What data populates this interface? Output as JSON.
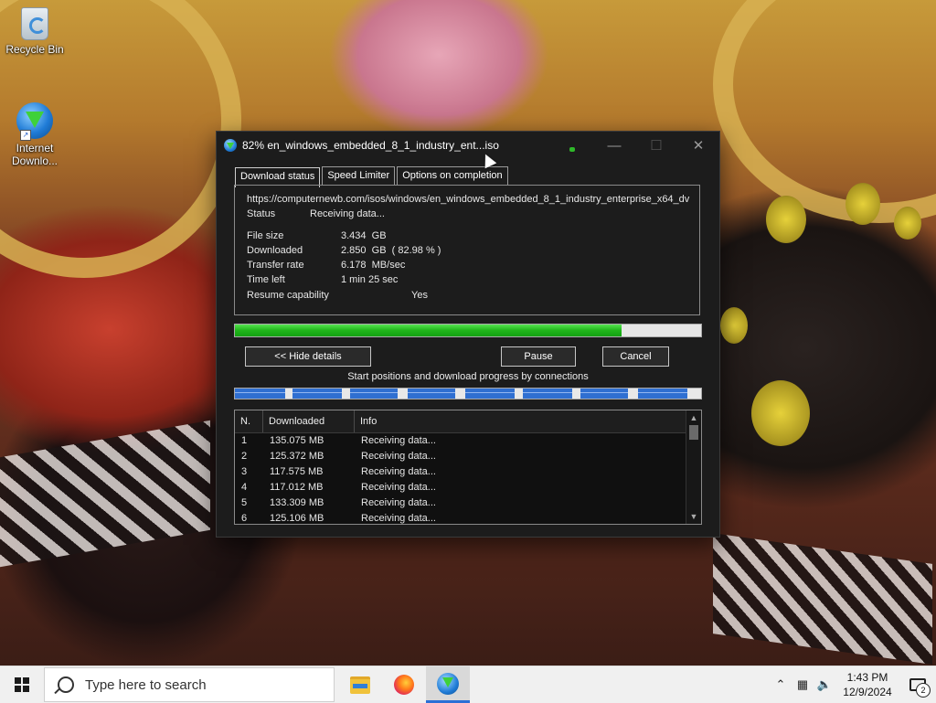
{
  "desktop": {
    "icons": [
      {
        "label": "Recycle Bin",
        "icon": "recycle-bin-icon"
      },
      {
        "label": "Internet\nDownlo...",
        "icon": "idm-icon"
      }
    ]
  },
  "dialog": {
    "title": "82% en_windows_embedded_8_1_industry_ent...iso",
    "tabs": [
      "Download status",
      "Speed Limiter",
      "Options on completion"
    ],
    "active_tab": "Download status",
    "url": "https://computernewb.com/isos/windows/en_windows_embedded_8_1_industry_enterprise_x64_dv",
    "status_label": "Status",
    "status_value": "Receiving data...",
    "file_size_label": "File size",
    "file_size_value": "3.434  GB",
    "downloaded_label": "Downloaded",
    "downloaded_value": "2.850  GB  ( 82.98 % )",
    "transfer_rate_label": "Transfer rate",
    "transfer_rate_value": "6.178  MB/sec",
    "time_left_label": "Time left",
    "time_left_value": "1 min 25 sec",
    "resume_label": "Resume capability",
    "resume_value": "Yes",
    "progress_fraction": 0.8298,
    "hide_details_label": "<< Hide details",
    "pause_label": "Pause",
    "cancel_label": "Cancel",
    "connections_caption": "Start positions and download progress by connections",
    "table": {
      "headers": [
        "N.",
        "Downloaded",
        "Info"
      ],
      "rows": [
        [
          "1",
          "135.075  MB",
          "Receiving data..."
        ],
        [
          "2",
          "125.372  MB",
          "Receiving data..."
        ],
        [
          "3",
          "117.575  MB",
          "Receiving data..."
        ],
        [
          "4",
          "117.012  MB",
          "Receiving data..."
        ],
        [
          "5",
          "133.309  MB",
          "Receiving data..."
        ],
        [
          "6",
          "125.106  MB",
          "Receiving data..."
        ]
      ]
    },
    "colors": {
      "progress": "#20b51a",
      "connection_segment": "#2f6fd1",
      "background": "#1c1c1c"
    }
  },
  "taskbar": {
    "search_placeholder": "Type here to search",
    "apps": [
      "file-explorer-icon",
      "firefox-icon",
      "idm-icon"
    ],
    "time": "1:43 PM",
    "date": "12/9/2024",
    "notification_count": "2"
  }
}
